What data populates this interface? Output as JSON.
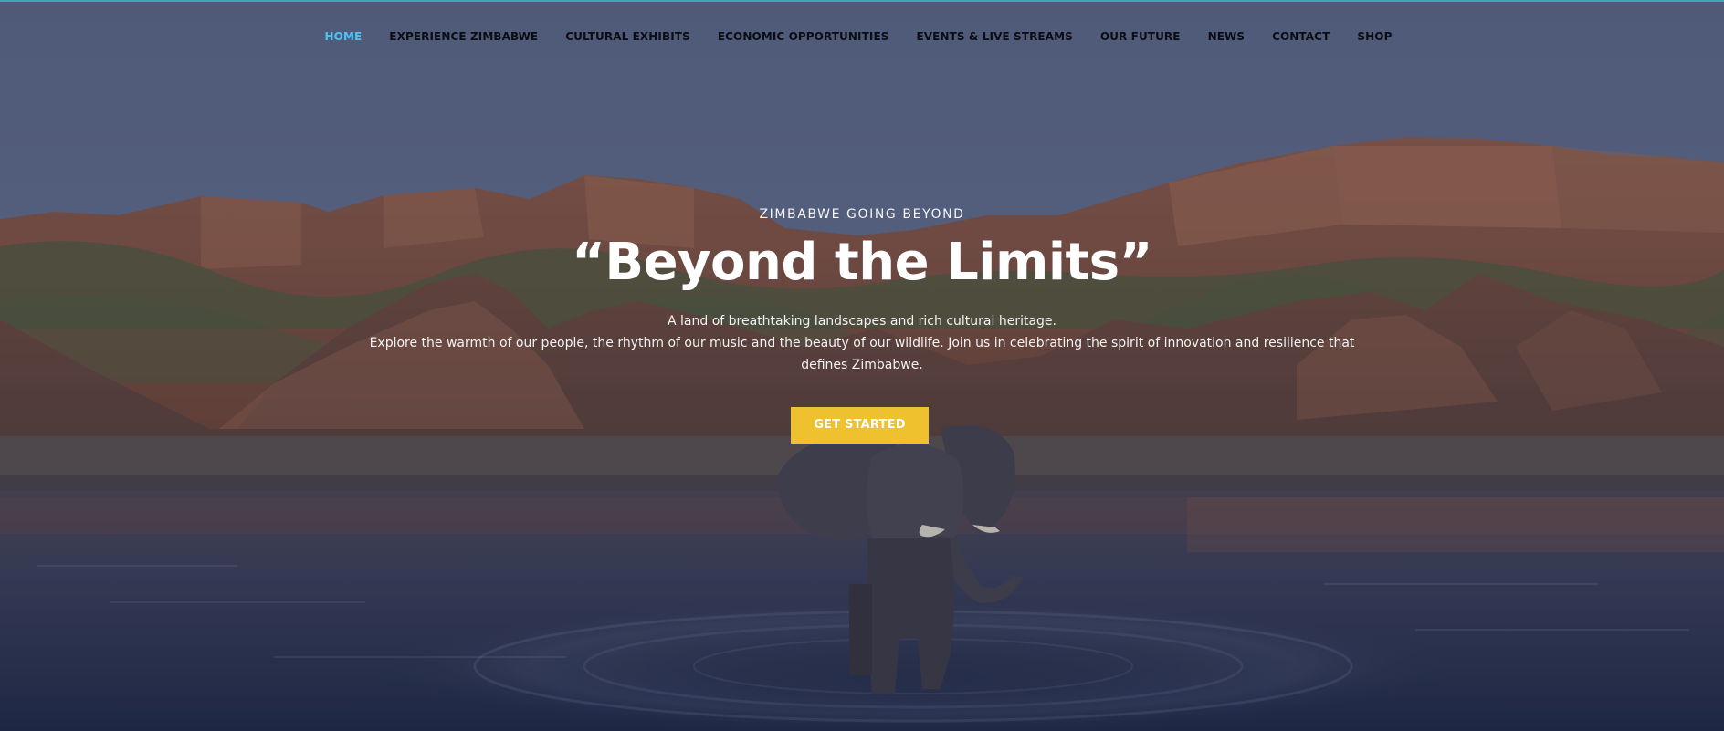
{
  "nav": {
    "items": [
      {
        "label": "HOME",
        "active": true
      },
      {
        "label": "EXPERIENCE ZIMBABWE",
        "active": false
      },
      {
        "label": "CULTURAL EXHIBITS",
        "active": false
      },
      {
        "label": "ECONOMIC OPPORTUNITIES",
        "active": false
      },
      {
        "label": "EVENTS & LIVE STREAMS",
        "active": false
      },
      {
        "label": "OUR FUTURE",
        "active": false
      },
      {
        "label": "NEWS",
        "active": false
      },
      {
        "label": "CONTACT",
        "active": false
      },
      {
        "label": "SHOP",
        "active": false
      }
    ]
  },
  "hero": {
    "eyebrow": "ZIMBABWE GOING BEYOND",
    "headline": "“Beyond the Limits”",
    "description_line1": "A land of breathtaking landscapes and rich cultural heritage.",
    "description_line2": "Explore the warmth of our people, the rhythm of our music and the beauty of our wildlife. Join us in celebrating the spirit of innovation and resilience that defines Zimbabwe.",
    "cta_label": "GET STARTED"
  },
  "colors": {
    "nav_active": "#4fc3f7",
    "nav_text": "#0b0d12",
    "cta_background": "#f0c12f",
    "overlay": "#3c4a63"
  },
  "background": {
    "subject": "elephant wading in river below red sandstone cliffs at dusk"
  }
}
